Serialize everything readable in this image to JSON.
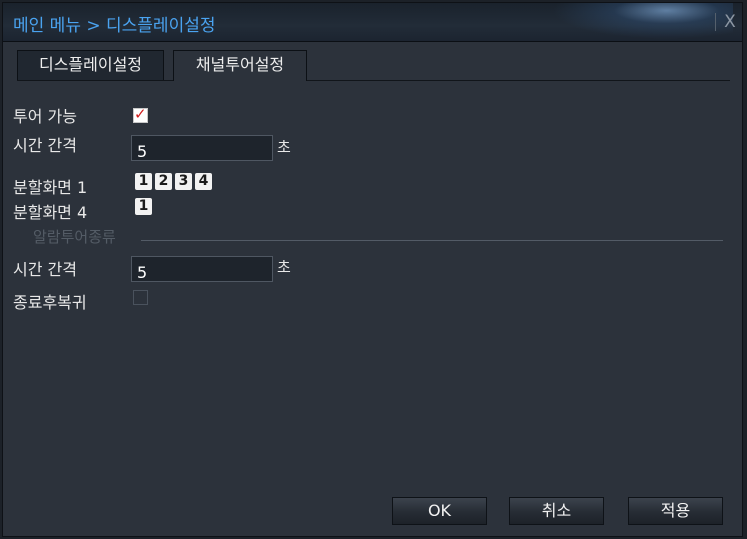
{
  "window": {
    "title": "메인 메뉴 > 디스플레이설정",
    "close_label": "X"
  },
  "tabs": [
    {
      "label": "디스플레이설정",
      "active": false
    },
    {
      "label": "채널투어설정",
      "active": true
    }
  ],
  "form": {
    "tour_enable": {
      "label": "투어 가능",
      "checked": true,
      "mark": "✓"
    },
    "interval": {
      "label": "시간 간격",
      "value": "5",
      "unit": "초"
    },
    "split1": {
      "label": "분할화면 1",
      "channels": [
        "1",
        "2",
        "3",
        "4"
      ]
    },
    "split4": {
      "label": "분할화면 4",
      "channels": [
        "1"
      ]
    },
    "alarm_section": {
      "label": "알람투어종류"
    },
    "alarm_interval": {
      "label": "시간 간격",
      "value": "5",
      "unit": "초"
    },
    "return_after": {
      "label": "종료후복귀",
      "checked": false
    }
  },
  "buttons": {
    "ok": "OK",
    "cancel": "취소",
    "apply": "적용"
  },
  "colors": {
    "title": "#4aa3f0",
    "background": "#2c323b",
    "check_mark": "#d21e1e"
  }
}
